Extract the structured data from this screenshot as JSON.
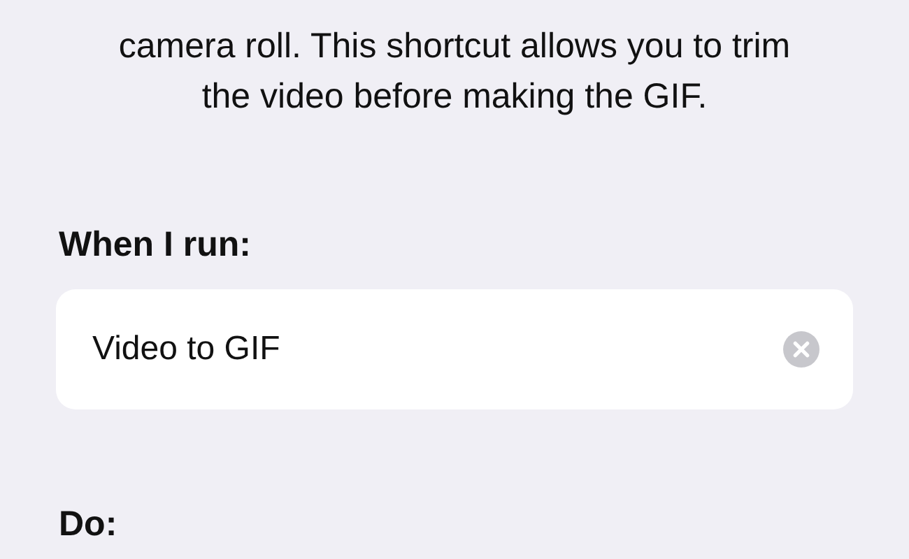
{
  "description": "camera roll. This shortcut allows you to trim the video before making the GIF.",
  "when_i_run": {
    "heading": "When I run:",
    "field": {
      "value": "Video to GIF"
    }
  },
  "do": {
    "heading": "Do:"
  }
}
